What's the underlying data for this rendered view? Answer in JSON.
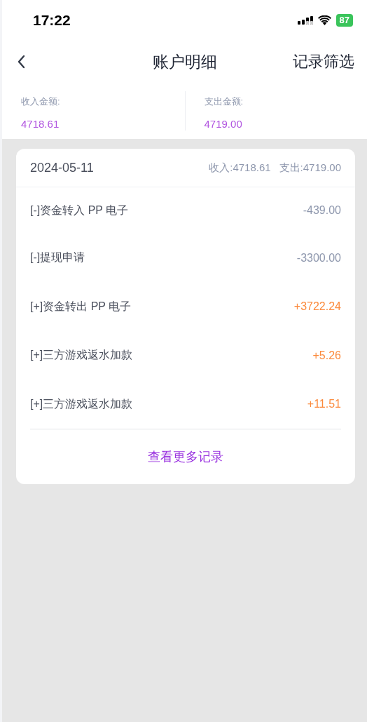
{
  "status_bar": {
    "time": "17:22",
    "battery": "87"
  },
  "nav": {
    "title": "账户明细",
    "action": "记录筛选"
  },
  "summary": [
    {
      "label": "收入金额:",
      "value": "4718.61"
    },
    {
      "label": "支出金额:",
      "value": "4719.00"
    }
  ],
  "day": {
    "date": "2024-05-11",
    "income": "收入:4718.61",
    "expense": "支出:4719.00",
    "records": [
      {
        "name": "[-]资金转入 PP 电子",
        "amount": "-439.00",
        "kind": "out"
      },
      {
        "name": "[-]提现申请",
        "amount": "-3300.00",
        "kind": "out"
      },
      {
        "name": "[+]资金转出 PP 电子",
        "amount": "+3722.24",
        "kind": "in"
      },
      {
        "name": "[+]三方游戏返水加款",
        "amount": "+5.26",
        "kind": "in"
      },
      {
        "name": "[+]三方游戏返水加款",
        "amount": "+11.51",
        "kind": "in"
      }
    ],
    "more": "查看更多记录"
  }
}
